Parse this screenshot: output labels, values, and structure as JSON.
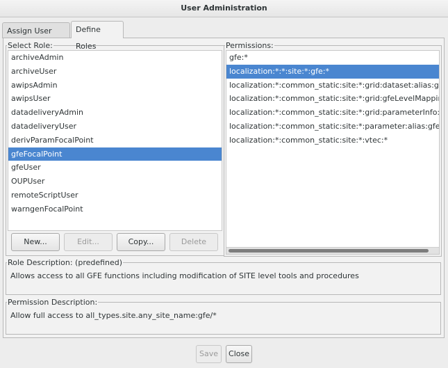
{
  "window": {
    "title": "User Administration"
  },
  "tabs": [
    {
      "label": "Assign User Roles",
      "active": false
    },
    {
      "label": "Define Roles",
      "active": true
    }
  ],
  "select_role": {
    "legend": "Select Role:",
    "items": [
      "archiveAdmin",
      "archiveUser",
      "awipsAdmin",
      "awipsUser",
      "datadeliveryAdmin",
      "datadeliveryUser",
      "derivParamFocalPoint",
      "gfeFocalPoint",
      "gfeUser",
      "OUPUser",
      "remoteScriptUser",
      "warngenFocalPoint"
    ],
    "selected": "gfeFocalPoint",
    "buttons": {
      "new": "New...",
      "edit": "Edit...",
      "copy": "Copy...",
      "delete": "Delete"
    }
  },
  "permissions": {
    "legend": "Permissions:",
    "items": [
      "gfe:*",
      "localization:*:*:site:*:gfe:*",
      "localization:*:common_static:site:*:grid:dataset:alias:gfe*.xml",
      "localization:*:common_static:site:*:grid:gfeLevelMappingFile.xml",
      "localization:*:common_static:site:*:grid:parameterInfo:*",
      "localization:*:common_static:site:*:parameter:alias:gfe*.xml",
      "localization:*:common_static:site:*:vtec:*"
    ],
    "selected": "localization:*:*:site:*:gfe:*"
  },
  "role_description": {
    "legend": "Role Description: (predefined)",
    "text": "Allows access to all GFE functions including modification of SITE level tools and procedures"
  },
  "permission_description": {
    "legend": "Permission Description:",
    "text": "Allow full access to all_types.site.any_site_name:gfe/*"
  },
  "footer": {
    "save": "Save",
    "close": "Close"
  },
  "colors": {
    "selection": "#4a86d0",
    "window_bg": "#ededed"
  }
}
